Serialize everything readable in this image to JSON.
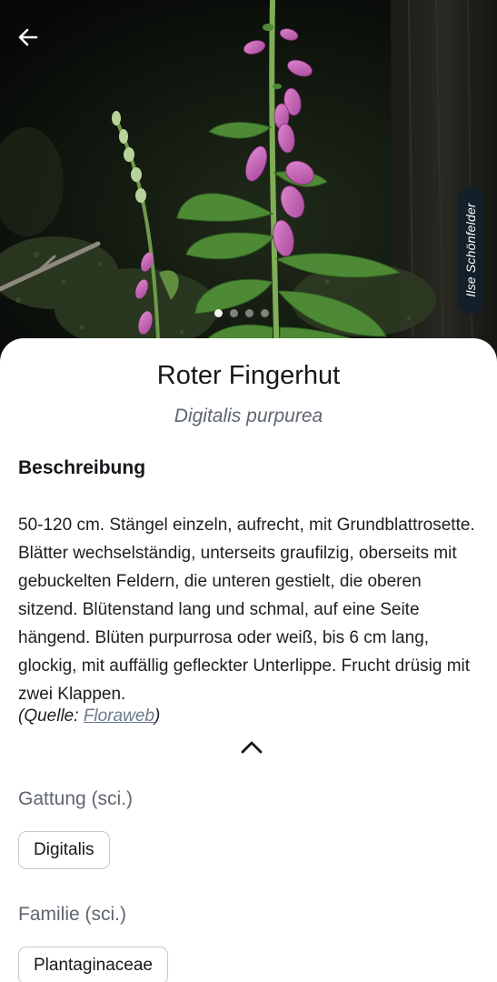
{
  "hero": {
    "credit": "Ilse Schönfelder",
    "slides_total": 4,
    "active_slide": 1
  },
  "plant": {
    "common_name": "Roter Fingerhut",
    "scientific_name": "Digitalis purpurea"
  },
  "description": {
    "title": "Beschreibung",
    "text": "50-120 cm. Stängel einzeln, aufrecht, mit Grundblattrosette. Blätter wechselständig, unterseits graufilzig, oberseits mit gebuckelten Feldern, die unteren gestielt, die oberen sitzend. Blütenstand lang und schmal, auf eine Seite hängend. Blüten purpurrosa oder weiß, bis 6 cm lang, glockig, mit auffällig gefleckter Unterlippe. Frucht drüsig mit zwei Klappen.",
    "source_prefix": "(Quelle: ",
    "source_link": "Floraweb",
    "source_suffix": ")"
  },
  "taxonomy": {
    "genus_label": "Gattung (sci.)",
    "genus_value": "Digitalis",
    "family_label": "Familie (sci.)",
    "family_value": "Plantaginaceae"
  },
  "icons": {
    "back": "arrow-left-icon",
    "collapse": "chevron-up-icon"
  },
  "colors": {
    "flower": "#c85fb5",
    "credit_bg": "#12202a"
  }
}
